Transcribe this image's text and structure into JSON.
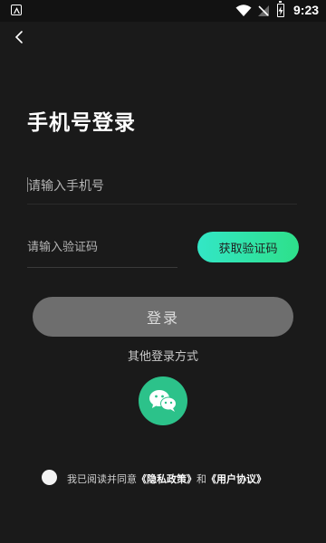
{
  "status_bar": {
    "time": "9:23",
    "icons": [
      "app-notification-icon",
      "wifi-icon",
      "no-signal-icon",
      "battery-charging-icon"
    ]
  },
  "header": {
    "back_icon": "chevron-left-icon"
  },
  "page": {
    "title": "手机号登录",
    "phone_placeholder": "请输入手机号",
    "phone_value": "",
    "code_placeholder": "请输入验证码",
    "code_value": "",
    "get_code_label": "获取验证码",
    "login_label": "登录",
    "other_login_label": "其他登录方式",
    "wechat_icon": "wechat-icon"
  },
  "agreement": {
    "prefix": "我已阅读并同意",
    "privacy_label": "《隐私政策》",
    "and_label": "和",
    "user_agreement_label": "《用户协议》",
    "checked": false
  },
  "colors": {
    "background": "#1a1a1a",
    "accent_gradient_start": "#33e6c6",
    "accent_gradient_end": "#2ee08a",
    "login_button": "#6e6e6e",
    "wechat": "#2cc28a"
  }
}
